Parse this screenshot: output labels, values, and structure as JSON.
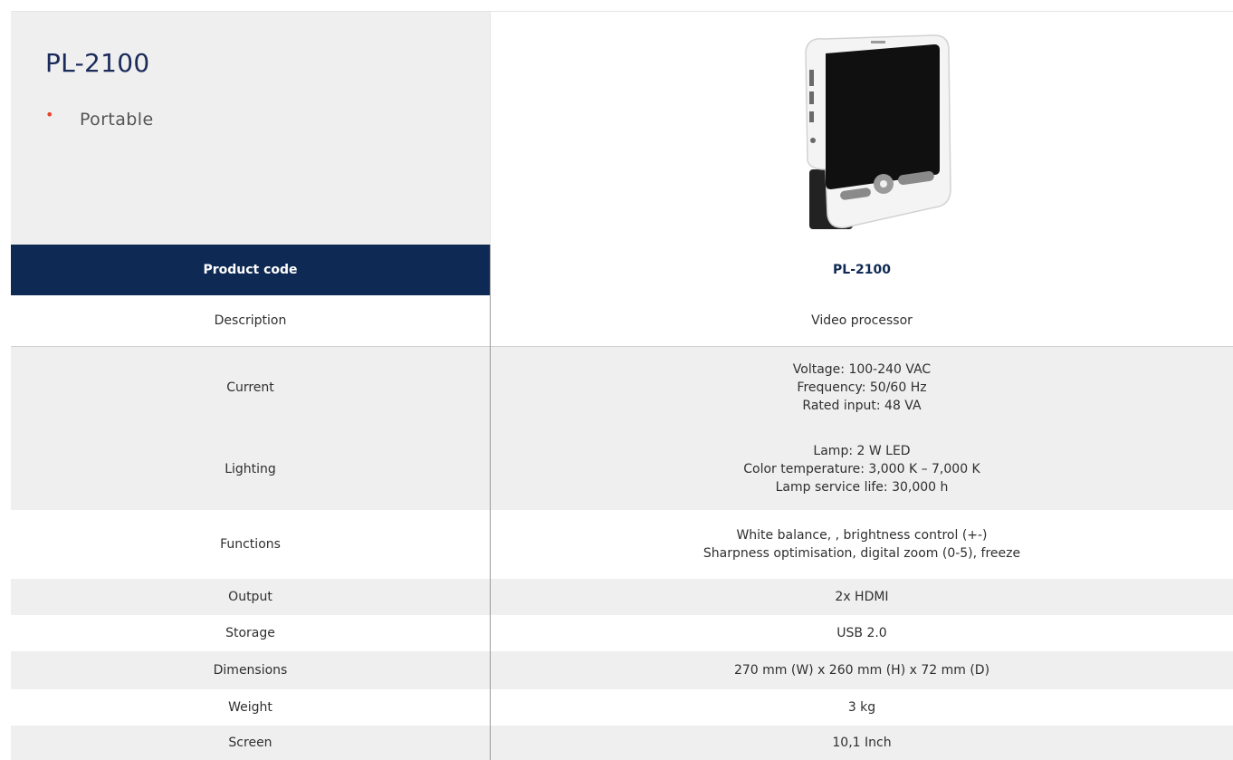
{
  "product": {
    "title": "PL-2100",
    "bullets": [
      "Portable"
    ]
  },
  "image": {
    "icon": "portable-video-processor-device-image"
  },
  "table": {
    "header": {
      "key": "Product code",
      "value": "PL-2100"
    },
    "rows": [
      {
        "key": "Description",
        "lines": [
          "Video processor"
        ]
      },
      {
        "key": "Current",
        "lines": [
          "Voltage: 100-240 VAC",
          "Frequency: 50/60 Hz",
          "Rated input: 48 VA"
        ]
      },
      {
        "key": "Lighting",
        "lines": [
          "Lamp: 2 W LED",
          "Color temperature: 3,000 K – 7,000 K",
          "Lamp service life: 30,000 h"
        ]
      },
      {
        "key": "Functions",
        "lines": [
          "White balance, , brightness control (+-)",
          "Sharpness optimisation, digital zoom (0-5), freeze"
        ]
      },
      {
        "key": "Output",
        "lines": [
          "2x HDMI"
        ]
      },
      {
        "key": "Storage",
        "lines": [
          "USB 2.0"
        ]
      },
      {
        "key": "Dimensions",
        "lines": [
          "270 mm (W) x 260 mm (H) x 72 mm (D)"
        ]
      },
      {
        "key": "Weight",
        "lines": [
          "3 kg"
        ]
      },
      {
        "key": "Screen",
        "lines": [
          "10,1 Inch"
        ]
      }
    ]
  },
  "colors": {
    "header_bg": "#0e2953",
    "accent_bullet": "#e8442c",
    "row_alt": "#efefef"
  }
}
